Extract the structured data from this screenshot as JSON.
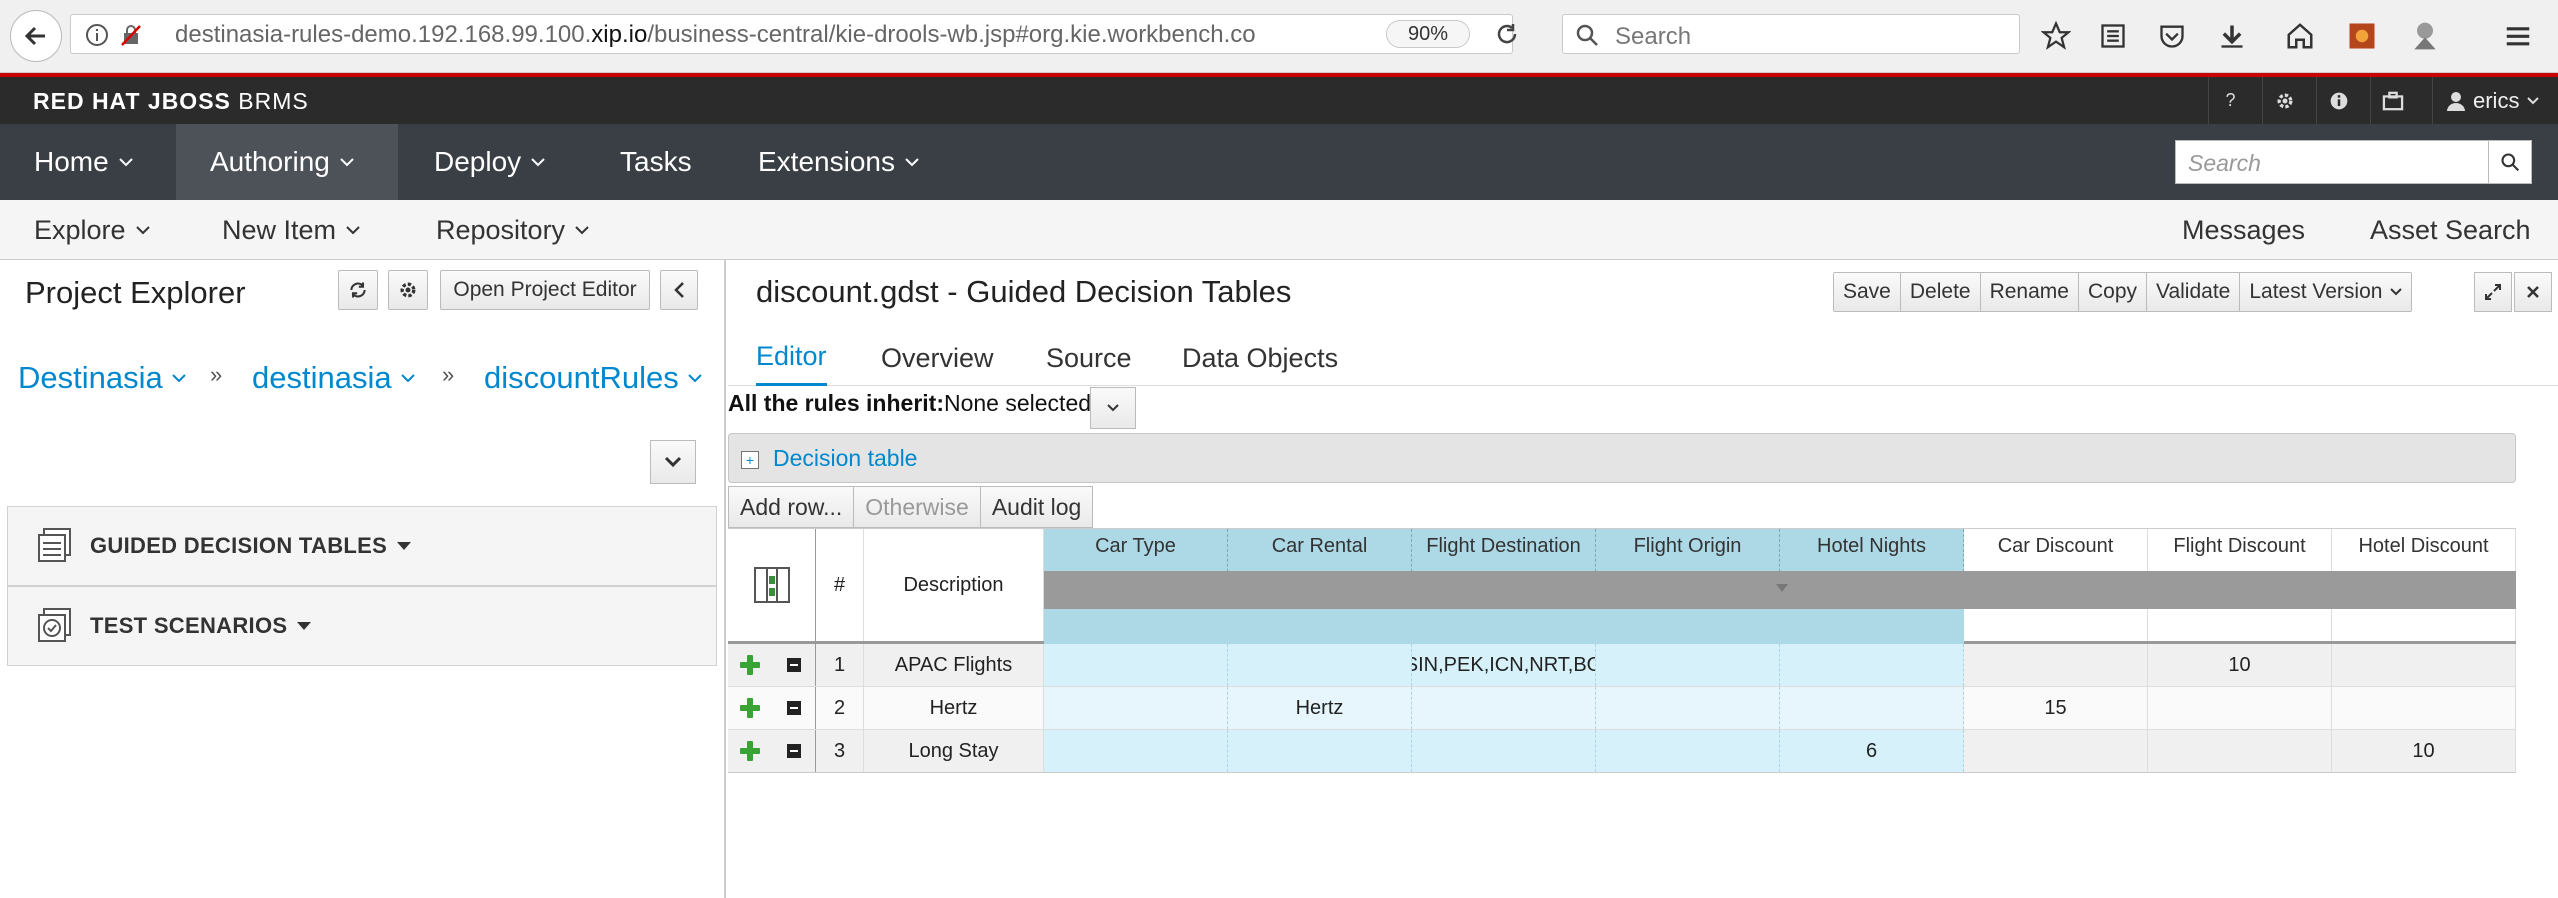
{
  "browser": {
    "url_prefix": "destinasia-rules-demo.192.168.99.100.",
    "url_domain": "xip.io",
    "url_path": "/business-central/kie-drools-wb.jsp#org.kie.workbench.co",
    "zoom": "90%",
    "search_placeholder": "Search"
  },
  "brand": {
    "part1": "RED HAT",
    "part2": "JBOSS",
    "part3": "BRMS"
  },
  "header_utils": {
    "help": "?",
    "user": "erics"
  },
  "nav": {
    "items": [
      "Home",
      "Authoring",
      "Deploy",
      "Tasks",
      "Extensions"
    ],
    "search_placeholder": "Search"
  },
  "subnav": {
    "left": [
      "Explore",
      "New Item",
      "Repository"
    ],
    "right": [
      "Messages",
      "Asset Search"
    ]
  },
  "project_explorer": {
    "title": "Project Explorer",
    "open_editor": "Open Project Editor",
    "breadcrumbs": [
      "Destinasia",
      "destinasia",
      "discountRules"
    ],
    "sections": [
      "GUIDED DECISION TABLES",
      "TEST SCENARIOS"
    ]
  },
  "editor": {
    "title": "discount.gdst - Guided Decision Tables",
    "toolbar": [
      "Save",
      "Delete",
      "Rename",
      "Copy",
      "Validate",
      "Latest Version"
    ],
    "tabs": [
      "Editor",
      "Overview",
      "Source",
      "Data Objects"
    ],
    "inherit_label": "All the rules inherit:",
    "inherit_value": "None selected",
    "decision_table": "Decision table",
    "grid_buttons": [
      "Add row...",
      "Otherwise",
      "Audit log"
    ]
  },
  "table": {
    "headers": [
      "#",
      "Description",
      "Car Type",
      "Car Rental",
      "Flight Destination",
      "Flight Origin",
      "Hotel Nights",
      "Car Discount",
      "Flight Discount",
      "Hotel Discount"
    ],
    "rows": [
      [
        "1",
        "APAC Flights",
        "",
        "",
        "SIN,PEK,ICN,NRT,BO",
        "",
        "",
        "",
        "10",
        ""
      ],
      [
        "2",
        "Hertz",
        "",
        "Hertz",
        "",
        "",
        "",
        "15",
        "",
        ""
      ],
      [
        "3",
        "Long Stay",
        "",
        "",
        "",
        "",
        "6",
        "",
        "",
        "10"
      ]
    ]
  }
}
